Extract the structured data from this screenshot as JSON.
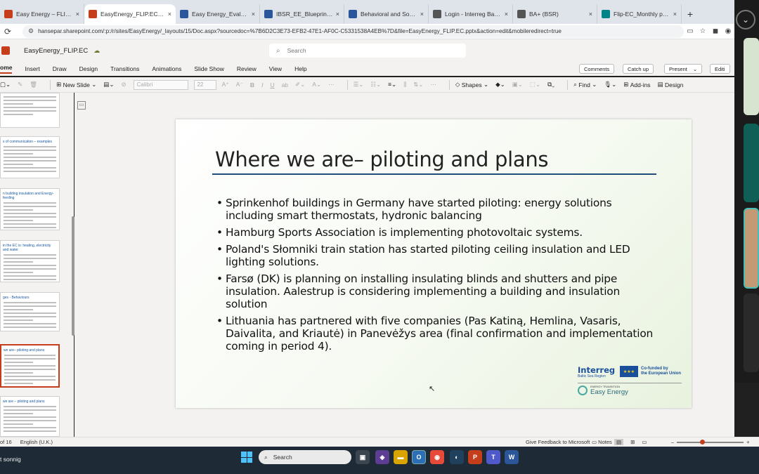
{
  "browser": {
    "tabs": [
      {
        "title": "Easy Energy – FLIP_EC_Au",
        "icon": "powerpoint-icon",
        "color": "#c43e1c"
      },
      {
        "title": "EasyEnergy_FLIP.EC.pptx",
        "icon": "powerpoint-icon",
        "color": "#c43e1c",
        "active": true
      },
      {
        "title": "Easy Energy_Evaluation fo",
        "icon": "word-icon",
        "color": "#2b579a"
      },
      {
        "title": "IBSR_EE_Blueprints_Collec",
        "icon": "word-icon",
        "color": "#2b579a"
      },
      {
        "title": "Behavioral and Social Car",
        "icon": "word-icon",
        "color": "#2b579a"
      },
      {
        "title": "Login - Interreg Baltic Sea",
        "icon": "link-icon",
        "color": "#555555"
      },
      {
        "title": "BA+ (BSR)",
        "icon": "link-icon",
        "color": "#555555"
      },
      {
        "title": "Flip-EC_Monthly project m",
        "icon": "sharepoint-icon",
        "color": "#038387"
      }
    ],
    "new_tab": "+",
    "url": "hansepar.sharepoint.com/:p:/r/sites/EasyEnergy/_layouts/15/Doc.aspx?sourcedoc=%7B6D2C3E73-EFB2-47E1-AF0C-C5331538A4EB%7D&file=EasyEnergy_FLIP.EC.pptx&action=edit&mobileredirect=true"
  },
  "app": {
    "file_name": "EasyEnergy_FLIP.EC",
    "search_placeholder": "Search",
    "menu": [
      "ome",
      "Insert",
      "Draw",
      "Design",
      "Transitions",
      "Animations",
      "Slide Show",
      "Review",
      "View",
      "Help"
    ],
    "menu_buttons": {
      "comments": "Comments",
      "catch_up": "Catch up",
      "present": "Present",
      "editing": "Editi"
    },
    "ribbon": {
      "new_slide": "New Slide",
      "font": "Calibri",
      "font_size": "22",
      "shapes": "Shapes",
      "find": "Find",
      "addins": "Add-ins",
      "designer": "Design"
    }
  },
  "thumbnails": [
    {
      "title": ""
    },
    {
      "title": "s of communication – examples"
    },
    {
      "title": "n building insulation and Energy-feeding"
    },
    {
      "title": "in the EC is: heating, electricity and water"
    },
    {
      "title": "ges - Behaviours"
    },
    {
      "title": "we are– piloting and plans",
      "selected": true
    },
    {
      "title": "we are – piloting and plans"
    }
  ],
  "slide": {
    "title": "Where we are– piloting and plans",
    "bullets": [
      "Sprinkenhof buildings in Germany have started piloting: energy solutions including smart thermostats, hydronic balancing",
      "Hamburg Sports Association is implementing photovoltaic systems.",
      "Poland's Słomniki train station has started piloting ceiling insulation and LED lighting solutions.",
      "Farsø (DK) is planning on installing insulating blinds and shutters and pipe insulation. Aalestrup is considering implementing a building and insulation solution",
      "Lithuania has partnered with five companies (Pas Katiną, Hemlina, Vasaris, Daivalita, and Kriautė) in Panevėžys area (final confirmation and implementation coming in period 4)."
    ],
    "logos": {
      "interreg": "Interreg",
      "interreg_sub": "Baltic Sea Region",
      "eu_line1": "Co-funded by",
      "eu_line2": "the European Union",
      "ee_small": "ENERGY TRANSITION",
      "ee_name": "Easy Energy"
    }
  },
  "status": {
    "slide_of": "of 16",
    "language": "English (U.K.)",
    "feedback": "Give Feedback to Microsoft",
    "notes": "Notes",
    "zoom_minus": "–",
    "zoom_plus": "+"
  },
  "taskbar": {
    "weather": "t sonnig",
    "search": "Search"
  }
}
